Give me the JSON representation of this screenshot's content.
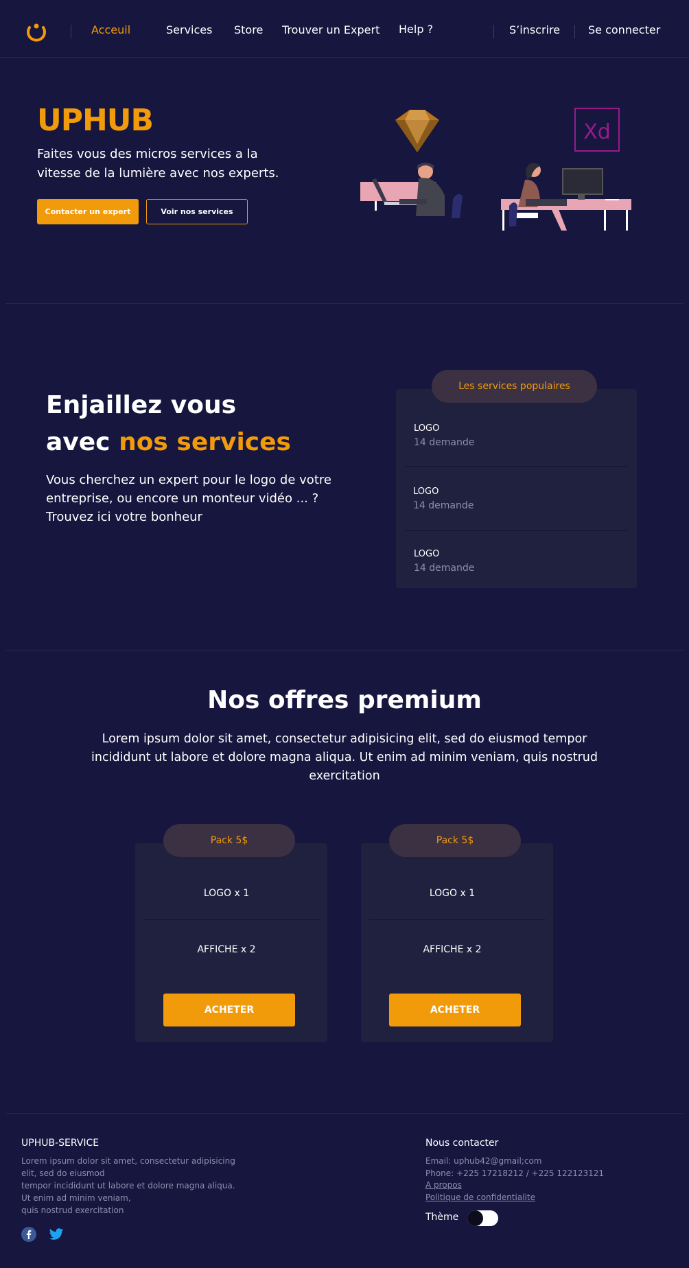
{
  "nav": {
    "links": [
      {
        "label": "Acceuil",
        "active": true
      },
      {
        "label": "Services"
      },
      {
        "label": "Store"
      },
      {
        "label": "Trouver un Expert"
      },
      {
        "label": "Help ?"
      }
    ],
    "signup": "S’inscrire",
    "login": "Se connecter",
    "logo_icon": "power-logo-icon"
  },
  "hero": {
    "title": "UPHUB",
    "subtitle": "Faites vous des micros services a la vitesse de la lumière avec nos experts.",
    "primary_button": "Contacter un expert",
    "secondary_button": "Voir nos services",
    "illustration_icons": [
      "sketch-icon",
      "xd-icon"
    ],
    "xd_label": "Xd"
  },
  "services": {
    "title_line1": "Enjaillez vous",
    "title_line2_prefix": "avec ",
    "title_line2_highlight": "nos services",
    "description": "Vous cherchez un expert pour le logo de votre entreprise, ou encore un monteur vidéo ... ? Trouvez ici votre bonheur",
    "card_tag": "Les services populaires",
    "items": [
      {
        "name": "LOGO",
        "requests": "14 demande"
      },
      {
        "name": "LOGO",
        "requests": "14 demande"
      },
      {
        "name": "LOGO",
        "requests": "14 demande"
      }
    ]
  },
  "premium": {
    "title": "Nos offres premium",
    "description": "Lorem ipsum dolor sit amet, consectetur adipisicing elit, sed do eiusmod tempor incididunt ut labore et dolore magna aliqua. Ut enim ad minim veniam, quis nostrud exercitation",
    "packs": [
      {
        "name": "Pack 5$",
        "items": [
          "LOGO x 1",
          "AFFICHE x 2"
        ],
        "button": "ACHETER"
      },
      {
        "name": "Pack 5$",
        "items": [
          "LOGO x 1",
          "AFFICHE x 2"
        ],
        "button": "ACHETER"
      }
    ]
  },
  "footer": {
    "brand_title": "UPHUB-SERVICE",
    "brand_text": [
      "Lorem ipsum dolor sit amet, consectetur adipisicing",
      "elit, sed do eiusmod",
      "tempor incididunt ut labore et dolore magna aliqua.",
      "Ut enim ad minim veniam,",
      "quis nostrud exercitation"
    ],
    "social_icons": [
      "facebook-icon",
      "twitter-icon"
    ],
    "contact_title": "Nous contacter",
    "email": "Email: uphub42@gmail;com",
    "phone": "Phone: +225 17218212 / +225 122123121",
    "about_link": "A propos",
    "privacy_link": "Politique de confidentialite",
    "theme_label": "Thème",
    "theme_dark": false
  },
  "colors": {
    "background": "#16163f",
    "accent": "#f29b0a",
    "card": "#20213f",
    "muted_text": "#8e8fae"
  }
}
